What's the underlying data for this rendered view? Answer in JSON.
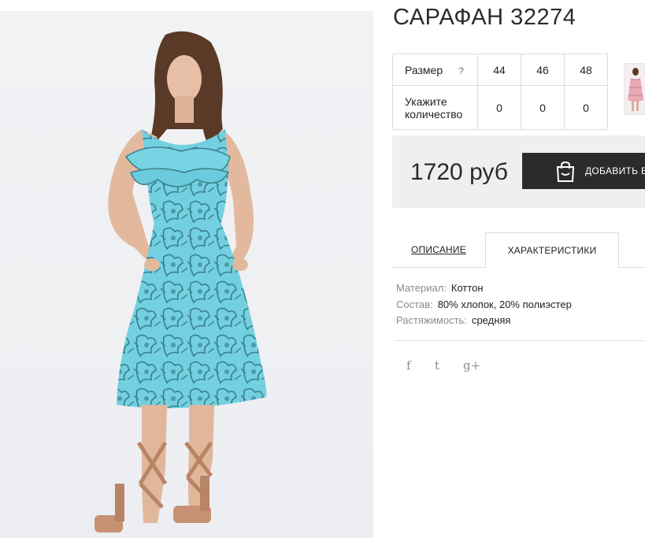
{
  "product": {
    "title": "САРАФАН 32274",
    "photo_alt": "photo"
  },
  "sizes": {
    "size_label": "Размер",
    "help_glyph": "?",
    "qty_label_line1": "Укажите",
    "qty_label_line2": "количество",
    "items": [
      {
        "size": "44",
        "qty": "0"
      },
      {
        "size": "46",
        "qty": "0"
      },
      {
        "size": "48",
        "qty": "0"
      }
    ]
  },
  "price": {
    "value": "1720 руб",
    "cart_button_label": "ДОБАВИТЬ В"
  },
  "tabs": [
    {
      "label": "ОПИСАНИЕ",
      "active": false
    },
    {
      "label": "ХАРАКТЕРИСТИКИ",
      "active": true
    }
  ],
  "characteristics": [
    {
      "key": "Материал:",
      "value": "Коттон"
    },
    {
      "key": "Состав:",
      "value": "80% хлопок, 20% полиэстер"
    },
    {
      "key": "Растяжимость:",
      "value": "средняя"
    }
  ],
  "social": {
    "facebook_glyph": "f",
    "twitter_glyph": "t",
    "google_glyph": "g+"
  },
  "colors": {
    "dress": "#6fcfe0",
    "dress_pattern": "#3d8a97",
    "button_bg": "#2b2b2b",
    "price_box_bg": "#efefef"
  },
  "icons": [
    "facebook-icon",
    "twitter-icon",
    "google-plus-icon",
    "shopping-bag-icon",
    "help-icon"
  ]
}
